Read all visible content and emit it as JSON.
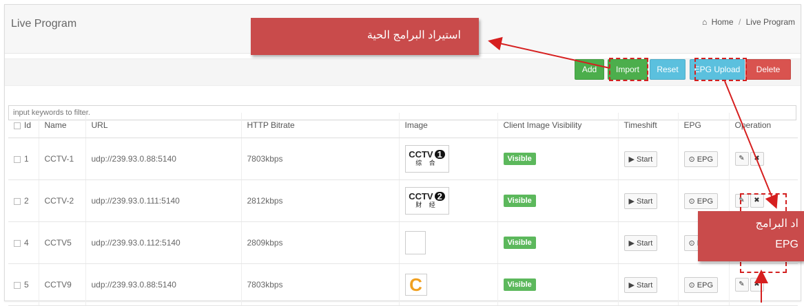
{
  "header": {
    "title": "Live Program",
    "breadcrumb": {
      "home": "Home",
      "separator": "/",
      "current": "Live Program"
    }
  },
  "toolbar": {
    "add": "Add",
    "import": "Import",
    "reset": "Reset",
    "epg_upload": "EPG Upload",
    "delete": "Delete"
  },
  "filter": {
    "placeholder": "input keywords to filter."
  },
  "table": {
    "columns": [
      "Id",
      "Name",
      "URL",
      "HTTP Bitrate",
      "Image",
      "Client Image Visibility",
      "Timeshift",
      "EPG",
      "Operation"
    ],
    "rows": [
      {
        "id": "1",
        "name": "CCTV-1",
        "url": "udp://239.93.0.88:5140",
        "bitrate": "7803kbps",
        "logo": "CCTV",
        "logo_num": "1",
        "logo_sub": "综 合",
        "visibility": "Visible",
        "timeshift": "▶ Start",
        "epg": "⊙ EPG"
      },
      {
        "id": "2",
        "name": "CCTV-2",
        "url": "udp://239.93.0.111:5140",
        "bitrate": "2812kbps",
        "logo": "CCTV",
        "logo_num": "2",
        "logo_sub": "财 经",
        "visibility": "Visible",
        "timeshift": "▶ Start",
        "epg": "⊙ EPG"
      },
      {
        "id": "4",
        "name": "CCTV5",
        "url": "udp://239.93.0.112:5140",
        "bitrate": "2809kbps",
        "logo": "",
        "logo_num": "",
        "logo_sub": "",
        "visibility": "Visible",
        "timeshift": "▶ Start",
        "epg": "⊙ EPG"
      },
      {
        "id": "5",
        "name": "CCTV9",
        "url": "udp://239.93.0.88:5140",
        "bitrate": "7803kbps",
        "logo": "C",
        "logo_num": "",
        "logo_sub": "",
        "visibility": "Visible",
        "timeshift": "▶ Start",
        "epg": "⊙ EPG"
      }
    ]
  },
  "annotations": {
    "import_callout": "استيراد البرامج الحية",
    "epg_callout_line1": "اد البرامج",
    "epg_callout_line2": "EPG"
  },
  "colors": {
    "add": "#4cae4c",
    "import": "#4cae4c",
    "reset": "#5bc0de",
    "epg_upload": "#5bc0de",
    "delete": "#d9534f",
    "callout": "#c94b4b",
    "visible_badge": "#5cb85c"
  },
  "icons": {
    "home": "home-icon",
    "edit": "pencil-icon",
    "remove": "close-icon"
  }
}
